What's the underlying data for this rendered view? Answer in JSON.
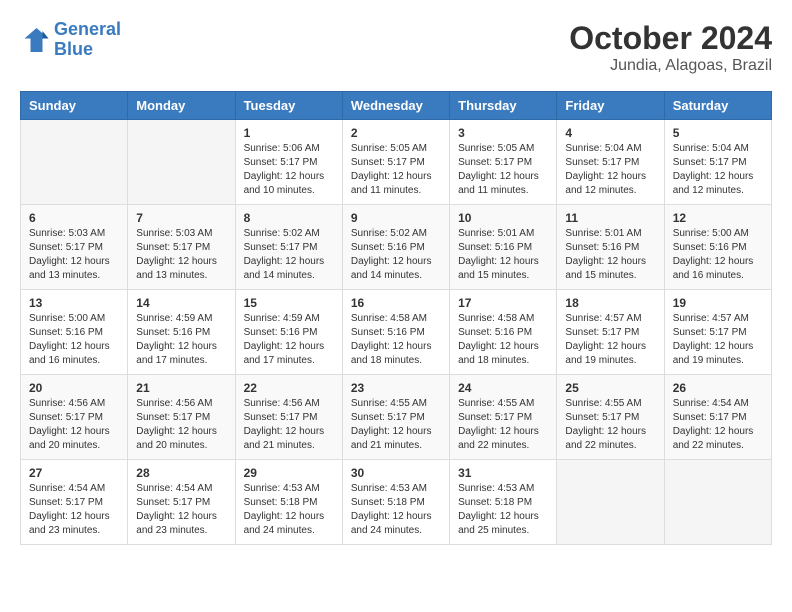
{
  "logo": {
    "line1": "General",
    "line2": "Blue"
  },
  "title": "October 2024",
  "subtitle": "Jundia, Alagoas, Brazil",
  "days_header": [
    "Sunday",
    "Monday",
    "Tuesday",
    "Wednesday",
    "Thursday",
    "Friday",
    "Saturday"
  ],
  "weeks": [
    [
      {
        "day": "",
        "info": ""
      },
      {
        "day": "",
        "info": ""
      },
      {
        "day": "1",
        "info": "Sunrise: 5:06 AM\nSunset: 5:17 PM\nDaylight: 12 hours\nand 10 minutes."
      },
      {
        "day": "2",
        "info": "Sunrise: 5:05 AM\nSunset: 5:17 PM\nDaylight: 12 hours\nand 11 minutes."
      },
      {
        "day": "3",
        "info": "Sunrise: 5:05 AM\nSunset: 5:17 PM\nDaylight: 12 hours\nand 11 minutes."
      },
      {
        "day": "4",
        "info": "Sunrise: 5:04 AM\nSunset: 5:17 PM\nDaylight: 12 hours\nand 12 minutes."
      },
      {
        "day": "5",
        "info": "Sunrise: 5:04 AM\nSunset: 5:17 PM\nDaylight: 12 hours\nand 12 minutes."
      }
    ],
    [
      {
        "day": "6",
        "info": "Sunrise: 5:03 AM\nSunset: 5:17 PM\nDaylight: 12 hours\nand 13 minutes."
      },
      {
        "day": "7",
        "info": "Sunrise: 5:03 AM\nSunset: 5:17 PM\nDaylight: 12 hours\nand 13 minutes."
      },
      {
        "day": "8",
        "info": "Sunrise: 5:02 AM\nSunset: 5:17 PM\nDaylight: 12 hours\nand 14 minutes."
      },
      {
        "day": "9",
        "info": "Sunrise: 5:02 AM\nSunset: 5:16 PM\nDaylight: 12 hours\nand 14 minutes."
      },
      {
        "day": "10",
        "info": "Sunrise: 5:01 AM\nSunset: 5:16 PM\nDaylight: 12 hours\nand 15 minutes."
      },
      {
        "day": "11",
        "info": "Sunrise: 5:01 AM\nSunset: 5:16 PM\nDaylight: 12 hours\nand 15 minutes."
      },
      {
        "day": "12",
        "info": "Sunrise: 5:00 AM\nSunset: 5:16 PM\nDaylight: 12 hours\nand 16 minutes."
      }
    ],
    [
      {
        "day": "13",
        "info": "Sunrise: 5:00 AM\nSunset: 5:16 PM\nDaylight: 12 hours\nand 16 minutes."
      },
      {
        "day": "14",
        "info": "Sunrise: 4:59 AM\nSunset: 5:16 PM\nDaylight: 12 hours\nand 17 minutes."
      },
      {
        "day": "15",
        "info": "Sunrise: 4:59 AM\nSunset: 5:16 PM\nDaylight: 12 hours\nand 17 minutes."
      },
      {
        "day": "16",
        "info": "Sunrise: 4:58 AM\nSunset: 5:16 PM\nDaylight: 12 hours\nand 18 minutes."
      },
      {
        "day": "17",
        "info": "Sunrise: 4:58 AM\nSunset: 5:16 PM\nDaylight: 12 hours\nand 18 minutes."
      },
      {
        "day": "18",
        "info": "Sunrise: 4:57 AM\nSunset: 5:17 PM\nDaylight: 12 hours\nand 19 minutes."
      },
      {
        "day": "19",
        "info": "Sunrise: 4:57 AM\nSunset: 5:17 PM\nDaylight: 12 hours\nand 19 minutes."
      }
    ],
    [
      {
        "day": "20",
        "info": "Sunrise: 4:56 AM\nSunset: 5:17 PM\nDaylight: 12 hours\nand 20 minutes."
      },
      {
        "day": "21",
        "info": "Sunrise: 4:56 AM\nSunset: 5:17 PM\nDaylight: 12 hours\nand 20 minutes."
      },
      {
        "day": "22",
        "info": "Sunrise: 4:56 AM\nSunset: 5:17 PM\nDaylight: 12 hours\nand 21 minutes."
      },
      {
        "day": "23",
        "info": "Sunrise: 4:55 AM\nSunset: 5:17 PM\nDaylight: 12 hours\nand 21 minutes."
      },
      {
        "day": "24",
        "info": "Sunrise: 4:55 AM\nSunset: 5:17 PM\nDaylight: 12 hours\nand 22 minutes."
      },
      {
        "day": "25",
        "info": "Sunrise: 4:55 AM\nSunset: 5:17 PM\nDaylight: 12 hours\nand 22 minutes."
      },
      {
        "day": "26",
        "info": "Sunrise: 4:54 AM\nSunset: 5:17 PM\nDaylight: 12 hours\nand 22 minutes."
      }
    ],
    [
      {
        "day": "27",
        "info": "Sunrise: 4:54 AM\nSunset: 5:17 PM\nDaylight: 12 hours\nand 23 minutes."
      },
      {
        "day": "28",
        "info": "Sunrise: 4:54 AM\nSunset: 5:17 PM\nDaylight: 12 hours\nand 23 minutes."
      },
      {
        "day": "29",
        "info": "Sunrise: 4:53 AM\nSunset: 5:18 PM\nDaylight: 12 hours\nand 24 minutes."
      },
      {
        "day": "30",
        "info": "Sunrise: 4:53 AM\nSunset: 5:18 PM\nDaylight: 12 hours\nand 24 minutes."
      },
      {
        "day": "31",
        "info": "Sunrise: 4:53 AM\nSunset: 5:18 PM\nDaylight: 12 hours\nand 25 minutes."
      },
      {
        "day": "",
        "info": ""
      },
      {
        "day": "",
        "info": ""
      }
    ]
  ]
}
